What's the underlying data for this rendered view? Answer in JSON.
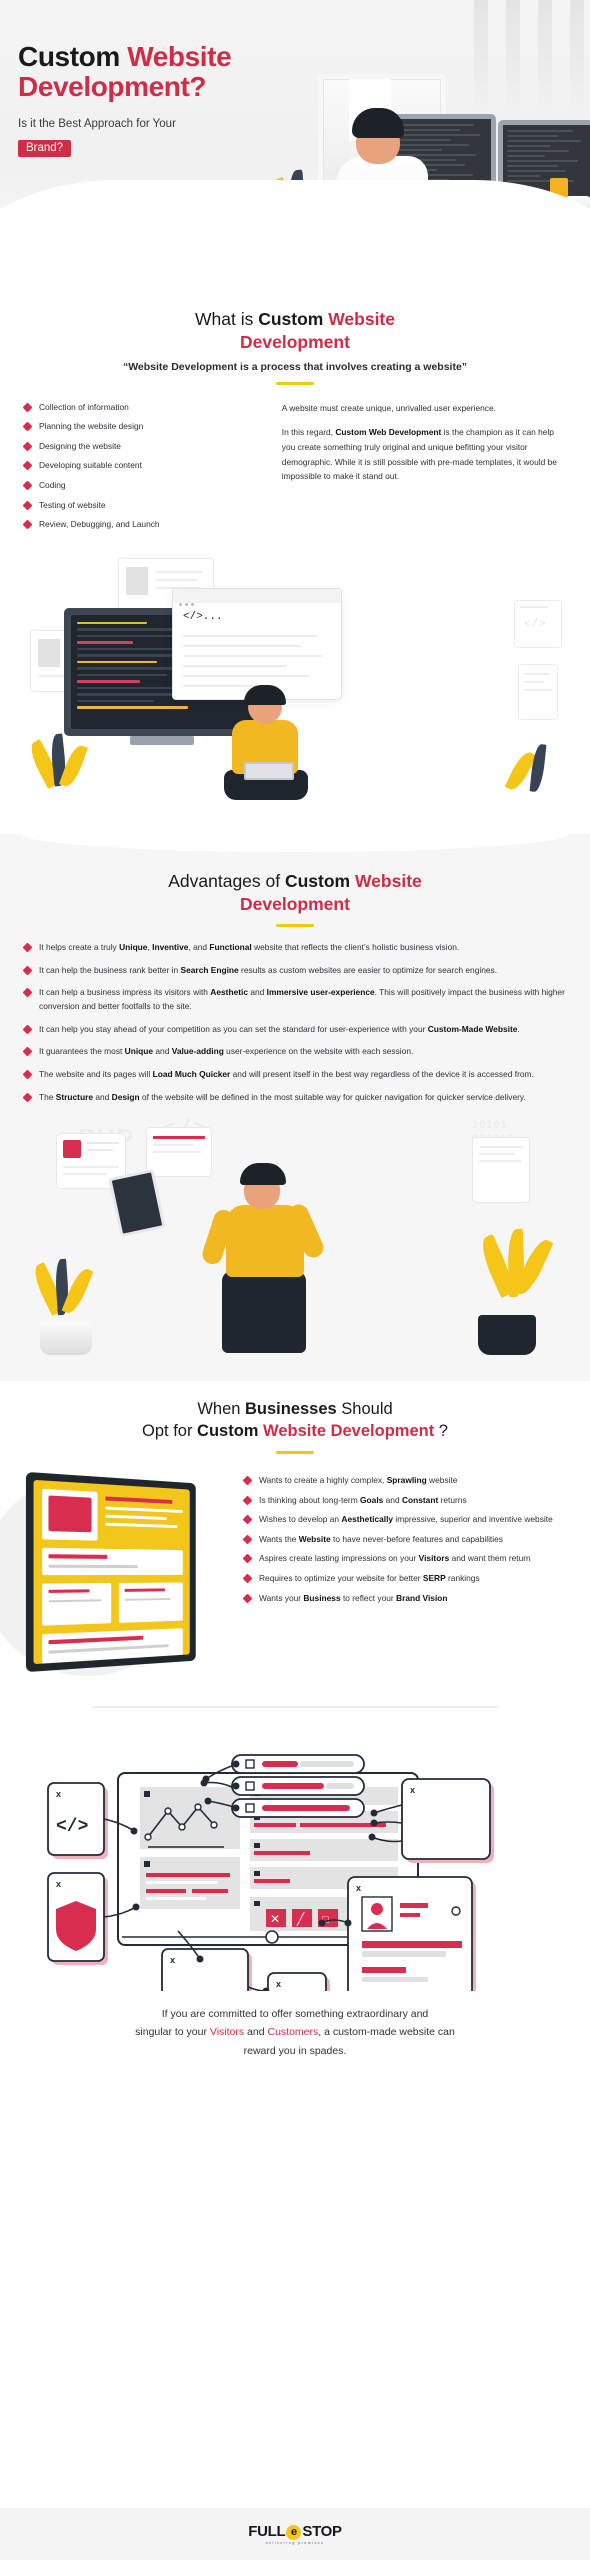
{
  "hero": {
    "title_line1_plain": "Custom ",
    "title_line1_accent": "Website",
    "title_line2_accent": "Development?",
    "subtitle": "Is it the Best Approach for Your",
    "badge": "Brand?"
  },
  "section_what": {
    "title_prefix": "What is ",
    "title_bold": "Custom ",
    "title_accent": "Website",
    "title_accent_line2": "Development",
    "quote": "“Website Development is a process that involves creating a website”",
    "bullets": [
      "Collection of information",
      "Planning the website design",
      "Designing the website",
      "Developing suitable content",
      "Coding",
      "Testing of website",
      "Review, Debugging, and Launch"
    ],
    "paragraph_1": "A website must create unique, unrivalled user experience.",
    "paragraph_2_part1": "In this regard, ",
    "paragraph_2_bold": "Custom Web Development",
    "paragraph_2_part2": " is the champion as it can help you create something truly original and unique befitting your visitor demographic. While it is still possible with pre-made templates, it would be impossible to make it stand out."
  },
  "illustration_code": {
    "code_tag": "</>...",
    "window_dots": "•••"
  },
  "section_advantages": {
    "title_prefix": "Advantages of ",
    "title_bold": "Custom ",
    "title_accent": "Website",
    "title_accent_line2": "Development",
    "bullets": [
      {
        "text_before": "It helps create a truly ",
        "bold1": "Unique",
        "mid1": ", ",
        "bold2": "Inventive",
        "mid2": ", and ",
        "bold3": "Functional",
        "text_after": " website that reflects the client’s holistic business vision."
      },
      {
        "text_before": "It can help the business rank better in ",
        "bold1": "Search Engine",
        "text_after": " results as custom websites are easier to optimize for search engines."
      },
      {
        "text_before": "It can help a business impress its visitors with ",
        "bold1": "Aesthetic",
        "mid1": " and ",
        "bold2": "Immersive user-experience",
        "text_after": ". This will positively impact the business with higher conversion and better footfalls to the site."
      },
      {
        "text_before": "It can help you stay ahead of your competition as you can set the standard for user-experience with your ",
        "bold1": "Custom-Made Website",
        "text_after": "."
      },
      {
        "text_before": "It guarantees the most ",
        "bold1": "Unique",
        "mid1": " and ",
        "bold2": "Value-adding",
        "text_after": " user-experience on the website with each session."
      },
      {
        "text_before": "The website and its pages will ",
        "bold1": "Load Much Quicker",
        "text_after": " and will present itself in the best way regardless of the device it is accessed from."
      },
      {
        "text_before": "The ",
        "bold1": "Structure",
        "mid1": " and ",
        "bold2": "Design",
        "text_after": " of the website will be defined in the most suitable way for quicker navigation for quicker service delivery."
      }
    ],
    "ghost_words": [
      "PHP",
      "</>",
      "10101 010110 0101101"
    ]
  },
  "section_when": {
    "title_line1_prefix": "When ",
    "title_line1_bold": "Businesses",
    "title_line1_suffix": " Should",
    "title_line2_prefix": "Opt for ",
    "title_line2_bold": "Custom ",
    "title_line2_accent": "Website Development",
    "title_line2_suffix": " ?",
    "bullets": [
      {
        "text_before": "Wants to create a highly complex, ",
        "bold1": "Sprawling",
        "text_after": " website"
      },
      {
        "text_before": "Is thinking about long-term ",
        "bold1": "Goals",
        "mid1": " and ",
        "bold2": "Constant",
        "text_after": " returns"
      },
      {
        "text_before": "Wishes to develop an ",
        "bold1": "Aesthetically",
        "text_after": " impressive, superior and inventive website"
      },
      {
        "text_before": "Wants the ",
        "bold1": "Website",
        "text_after": " to have never-before features and capabilities"
      },
      {
        "text_before": "Aspires create lasting impressions on your ",
        "bold1": "Visitors",
        "text_after": " and want them return"
      },
      {
        "text_before": "Requires to optimize your website for better ",
        "bold1": "SERP",
        "text_after": " rankings"
      },
      {
        "text_before": "Wants your ",
        "bold1": "Business",
        "mid1": " to reflect your ",
        "bold2": "Brand Vision",
        "text_after": ""
      }
    ]
  },
  "illustration_wireframe": {
    "code_icon": "</>",
    "close_icon": "x",
    "tool_icons": [
      "✕",
      "╱",
      "□"
    ]
  },
  "outro": {
    "line1": "If you are committed to offer something extraordinary and",
    "line2_part1": "singular to your ",
    "line2_red1": "Visitors",
    "line2_part2": " and ",
    "line2_red2": "Customers",
    "line2_part3": ", a custom-made website can",
    "line3": "reward you in spades."
  },
  "footer": {
    "logo_part1": "FULL",
    "logo_e": "e",
    "logo_part2": "STOP",
    "logo_tagline": "delivering promises"
  },
  "colors": {
    "accent_red": "#cf2d47",
    "bullet_red": "#d92d4f",
    "yellow": "#f5c518",
    "dark": "#1a1a1a",
    "band_bg": "#f6f6f6"
  }
}
